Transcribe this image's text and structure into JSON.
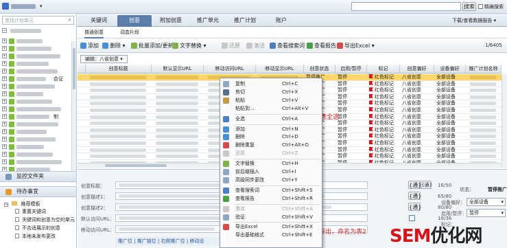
{
  "topbar": {
    "search_btn": "搜索",
    "exact_label": "精确搜索"
  },
  "left": {
    "search_placeholder": "查找计划单元",
    "tree_suffixes": {
      "r5": "合证",
      "r10": "制"
    },
    "sections": [
      {
        "label": "监控文件夹"
      },
      {
        "label": "待办事宜"
      }
    ],
    "recommend": {
      "title": "推荐模板",
      "items": [
        "重置关键词",
        "关键词和创意为空的单元",
        "不合适展示的创意",
        "本地未发布更改"
      ]
    }
  },
  "tabs": [
    "关键词",
    "创意",
    "附加创意",
    "推广单元",
    "推广计划",
    "账户"
  ],
  "tabs_active": 1,
  "top_right_link": "下载/查看数据报告",
  "subtabs": [
    "普通创意",
    "动态片段"
  ],
  "toolbar": {
    "add": "添加",
    "delete": "删除",
    "batch": "批量添加/更新",
    "replace": "文字替换",
    "restore": "还原",
    "activate": "激活",
    "view_search": "查看搜索词",
    "view_report": "查看报告",
    "export": "导出Excel",
    "pager": "1/6405"
  },
  "editbar": {
    "label": "编辑：八省创意"
  },
  "grid": {
    "headers": [
      "创意标题",
      "默认显示URL",
      "移动访问URL",
      "移动显示URL",
      "创意状态",
      "启用/暂停",
      "标记",
      "创意偏好",
      "设备偏好",
      "推广计划名称"
    ],
    "row_values": {
      "status": "暂停推广",
      "pause": "暂停",
      "mark": "红色标记",
      "pref": "八省创意",
      "device": "全部设备"
    },
    "row_count": 14
  },
  "detail": {
    "labels": [
      "创意标题：",
      "创意描述1：",
      "创意描述2：",
      "默认访问URL：",
      "移动访问URL："
    ],
    "wild": "{通}",
    "counts": [
      "16/50",
      "65/80",
      "80/80",
      "18/36"
    ],
    "status_label": "状态：",
    "status_value": "暂停推广",
    "device_label": "设备偏好：",
    "device_value": "全部设备",
    "pause_label": "启用/暂停：",
    "pause_value": "暂停",
    "mark_label": "标记：",
    "bottom_tabs": [
      "推广位",
      "推广链位",
      "右侧推广位",
      "移动设"
    ]
  },
  "menu": {
    "items": [
      {
        "label": "复制",
        "shortcut": "Ctrl+C",
        "icon": "copy-icon",
        "color": "#8ca7c4"
      },
      {
        "label": "剪切",
        "shortcut": "Ctrl+X",
        "icon": "cut-icon",
        "color": "#5a6f8c"
      },
      {
        "label": "粘贴",
        "shortcut": "Ctrl+V",
        "icon": "paste-icon",
        "color": "#c79a4a"
      },
      {
        "label": "粘贴到...",
        "shortcut": "Ctrl+Alt+V",
        "icon": "",
        "color": ""
      },
      {
        "label": "全选",
        "shortcut": "Ctrl+A",
        "icon": "select-all-icon",
        "color": "#4b7fc4"
      },
      {
        "label": "添加",
        "shortcut": "Ctrl+N",
        "icon": "add-icon",
        "color": "#4a8fd6"
      },
      {
        "label": "删除",
        "shortcut": "Ctrl+D",
        "icon": "delete-icon",
        "color": "#4a8fd6"
      },
      {
        "label": "删除重复",
        "shortcut": "Ctrl+Alt+D",
        "icon": "delete-duplicate-icon",
        "color": "#d64a4a"
      },
      {
        "label": "还原",
        "shortcut": "Ctrl+Z",
        "icon": "undo-icon",
        "color": "#c8c8c8",
        "disabled": true
      },
      {
        "label": "文字替换",
        "shortcut": "Ctrl+H",
        "icon": "replace-icon",
        "color": "#7fb24a"
      },
      {
        "label": "前后缀插入",
        "shortcut": "Ctrl+I",
        "icon": "insert-icon",
        "color": "#8ca7c4"
      },
      {
        "label": "高级同步更改",
        "shortcut": "Ctrl+Y",
        "icon": "sync-icon",
        "color": "#8ca7c4"
      },
      {
        "label": "查看搜索词",
        "shortcut": "Ctrl+Shift+S",
        "icon": "search-terms-icon",
        "color": "#4a7fc4"
      },
      {
        "label": "查看报告",
        "shortcut": "Ctrl+Shift+R",
        "icon": "report-icon",
        "color": "#4a9f4a"
      },
      {
        "label": "激活",
        "shortcut": "Ctrl+Shift+A",
        "icon": "activate-icon",
        "color": "#c8c8c8",
        "disabled": true
      },
      {
        "label": "验证",
        "shortcut": "Ctrl+Shift+V",
        "icon": "verify-icon",
        "color": "#8ca7c4"
      },
      {
        "label": "导出Excel",
        "shortcut": "Ctrl+Shift+X",
        "icon": "export-excel-icon",
        "color": "#d64a4a"
      },
      {
        "label": "导出基础格式",
        "shortcut": "Ctrl+Shift+E",
        "icon": "",
        "color": ""
      }
    ]
  },
  "annotations": {
    "a1": "②对整批创意进行创意全选",
    "a2": "③将创意全部导出，命名为表2"
  },
  "watermark": {
    "part1": "SEM",
    "part2": "优化网"
  },
  "colors": {
    "accent": "#5a7ea9",
    "selected_row": "#ffd769",
    "flag_red": "#d7141a",
    "annotation_red": "#e02020"
  }
}
